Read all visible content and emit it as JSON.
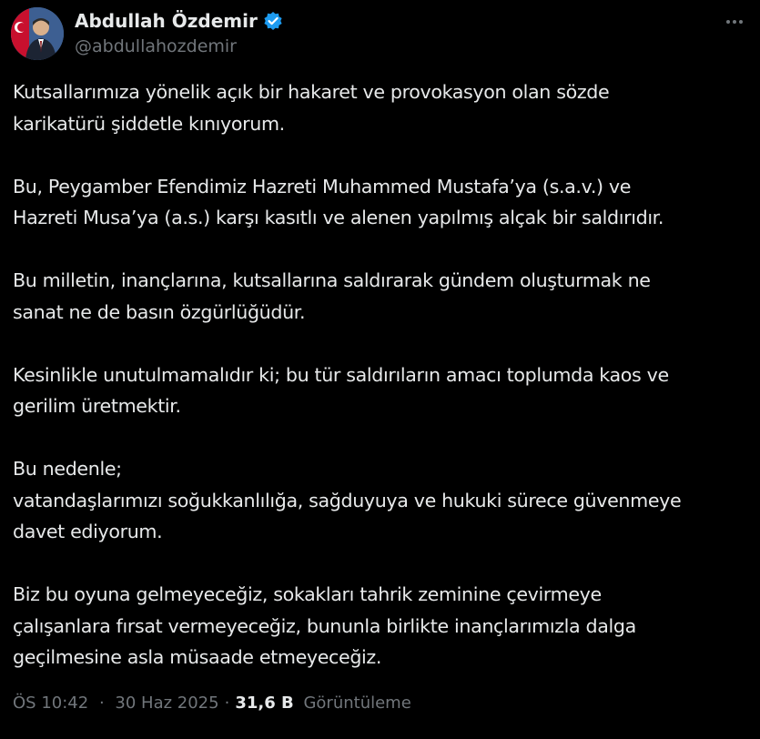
{
  "author": {
    "display_name": "Abdullah Özdemir",
    "handle": "@abdullahozdemir",
    "verified": true
  },
  "tweet": {
    "paragraphs": [
      [
        "Kutsallarımıza yönelik açık bir hakaret ve provokasyon olan sözde",
        "karikatürü şiddetle kınıyorum."
      ],
      [
        "Bu, Peygamber Efendimiz Hazreti Muhammed Mustafa’ya (s.a.v.) ve",
        "Hazreti Musa’ya (a.s.) karşı kasıtlı ve alenen yapılmış alçak bir saldırıdır."
      ],
      [
        "Bu milletin, inançlarına,  kutsallarına saldırarak gündem oluşturmak ne",
        "sanat ne de basın özgürlüğüdür."
      ],
      [
        "Kesinlikle unutulmamalıdır ki; bu tür saldırıların amacı toplumda kaos ve",
        "gerilim üretmektir."
      ],
      [
        "Bu nedenle;",
        "vatandaşlarımızı soğukkanlılığa, sağduyuya ve hukuki sürece güvenmeye",
        "davet ediyorum."
      ],
      [
        "Biz bu oyuna gelmeyeceğiz, sokakları tahrik zeminine çevirmeye",
        "çalışanlara fırsat vermeyeceğiz, bununla birlikte inançlarımızla dalga",
        "geçilmesine asla müsaade etmeyeceğiz."
      ]
    ],
    "time": "ÖS 10:42",
    "date": "30 Haz 2025",
    "separator": "·",
    "views_count": "31,6 B",
    "views_label": "Görüntüleme"
  },
  "icons": {
    "verified": "verified-badge-icon",
    "more": "more-options-icon"
  },
  "colors": {
    "background": "#000000",
    "text": "#e7e9ea",
    "secondary": "#71767b",
    "verified": "#1d9bf0"
  }
}
